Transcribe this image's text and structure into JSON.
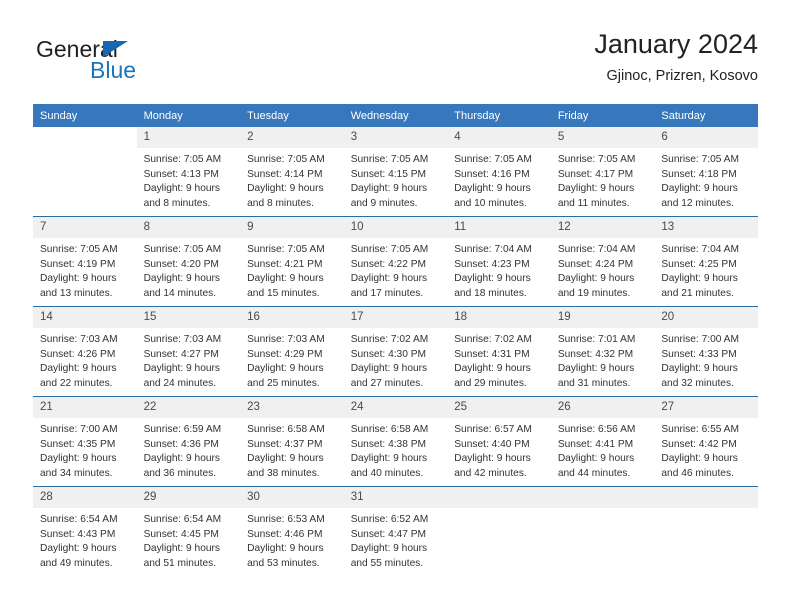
{
  "brand": {
    "name_part1": "General",
    "name_part2": "Blue"
  },
  "header": {
    "title": "January 2024",
    "subtitle": "Gjinoc, Prizren, Kosovo"
  },
  "weekday_headers": [
    "Sunday",
    "Monday",
    "Tuesday",
    "Wednesday",
    "Thursday",
    "Friday",
    "Saturday"
  ],
  "colors": {
    "header_band": "#3778bc",
    "week_divider": "#2b6ca3",
    "daynum_bg": "#f0f0f0",
    "brand_blue": "#1b75bb",
    "text": "#333333"
  },
  "weeks": [
    [
      {
        "day": "",
        "sunrise": "",
        "sunset": "",
        "daylight_line1": "",
        "daylight_line2": "",
        "empty": true
      },
      {
        "day": "1",
        "sunrise": "Sunrise: 7:05 AM",
        "sunset": "Sunset: 4:13 PM",
        "daylight_line1": "Daylight: 9 hours",
        "daylight_line2": "and 8 minutes."
      },
      {
        "day": "2",
        "sunrise": "Sunrise: 7:05 AM",
        "sunset": "Sunset: 4:14 PM",
        "daylight_line1": "Daylight: 9 hours",
        "daylight_line2": "and 8 minutes."
      },
      {
        "day": "3",
        "sunrise": "Sunrise: 7:05 AM",
        "sunset": "Sunset: 4:15 PM",
        "daylight_line1": "Daylight: 9 hours",
        "daylight_line2": "and 9 minutes."
      },
      {
        "day": "4",
        "sunrise": "Sunrise: 7:05 AM",
        "sunset": "Sunset: 4:16 PM",
        "daylight_line1": "Daylight: 9 hours",
        "daylight_line2": "and 10 minutes."
      },
      {
        "day": "5",
        "sunrise": "Sunrise: 7:05 AM",
        "sunset": "Sunset: 4:17 PM",
        "daylight_line1": "Daylight: 9 hours",
        "daylight_line2": "and 11 minutes."
      },
      {
        "day": "6",
        "sunrise": "Sunrise: 7:05 AM",
        "sunset": "Sunset: 4:18 PM",
        "daylight_line1": "Daylight: 9 hours",
        "daylight_line2": "and 12 minutes."
      }
    ],
    [
      {
        "day": "7",
        "sunrise": "Sunrise: 7:05 AM",
        "sunset": "Sunset: 4:19 PM",
        "daylight_line1": "Daylight: 9 hours",
        "daylight_line2": "and 13 minutes."
      },
      {
        "day": "8",
        "sunrise": "Sunrise: 7:05 AM",
        "sunset": "Sunset: 4:20 PM",
        "daylight_line1": "Daylight: 9 hours",
        "daylight_line2": "and 14 minutes."
      },
      {
        "day": "9",
        "sunrise": "Sunrise: 7:05 AM",
        "sunset": "Sunset: 4:21 PM",
        "daylight_line1": "Daylight: 9 hours",
        "daylight_line2": "and 15 minutes."
      },
      {
        "day": "10",
        "sunrise": "Sunrise: 7:05 AM",
        "sunset": "Sunset: 4:22 PM",
        "daylight_line1": "Daylight: 9 hours",
        "daylight_line2": "and 17 minutes."
      },
      {
        "day": "11",
        "sunrise": "Sunrise: 7:04 AM",
        "sunset": "Sunset: 4:23 PM",
        "daylight_line1": "Daylight: 9 hours",
        "daylight_line2": "and 18 minutes."
      },
      {
        "day": "12",
        "sunrise": "Sunrise: 7:04 AM",
        "sunset": "Sunset: 4:24 PM",
        "daylight_line1": "Daylight: 9 hours",
        "daylight_line2": "and 19 minutes."
      },
      {
        "day": "13",
        "sunrise": "Sunrise: 7:04 AM",
        "sunset": "Sunset: 4:25 PM",
        "daylight_line1": "Daylight: 9 hours",
        "daylight_line2": "and 21 minutes."
      }
    ],
    [
      {
        "day": "14",
        "sunrise": "Sunrise: 7:03 AM",
        "sunset": "Sunset: 4:26 PM",
        "daylight_line1": "Daylight: 9 hours",
        "daylight_line2": "and 22 minutes."
      },
      {
        "day": "15",
        "sunrise": "Sunrise: 7:03 AM",
        "sunset": "Sunset: 4:27 PM",
        "daylight_line1": "Daylight: 9 hours",
        "daylight_line2": "and 24 minutes."
      },
      {
        "day": "16",
        "sunrise": "Sunrise: 7:03 AM",
        "sunset": "Sunset: 4:29 PM",
        "daylight_line1": "Daylight: 9 hours",
        "daylight_line2": "and 25 minutes."
      },
      {
        "day": "17",
        "sunrise": "Sunrise: 7:02 AM",
        "sunset": "Sunset: 4:30 PM",
        "daylight_line1": "Daylight: 9 hours",
        "daylight_line2": "and 27 minutes."
      },
      {
        "day": "18",
        "sunrise": "Sunrise: 7:02 AM",
        "sunset": "Sunset: 4:31 PM",
        "daylight_line1": "Daylight: 9 hours",
        "daylight_line2": "and 29 minutes."
      },
      {
        "day": "19",
        "sunrise": "Sunrise: 7:01 AM",
        "sunset": "Sunset: 4:32 PM",
        "daylight_line1": "Daylight: 9 hours",
        "daylight_line2": "and 31 minutes."
      },
      {
        "day": "20",
        "sunrise": "Sunrise: 7:00 AM",
        "sunset": "Sunset: 4:33 PM",
        "daylight_line1": "Daylight: 9 hours",
        "daylight_line2": "and 32 minutes."
      }
    ],
    [
      {
        "day": "21",
        "sunrise": "Sunrise: 7:00 AM",
        "sunset": "Sunset: 4:35 PM",
        "daylight_line1": "Daylight: 9 hours",
        "daylight_line2": "and 34 minutes."
      },
      {
        "day": "22",
        "sunrise": "Sunrise: 6:59 AM",
        "sunset": "Sunset: 4:36 PM",
        "daylight_line1": "Daylight: 9 hours",
        "daylight_line2": "and 36 minutes."
      },
      {
        "day": "23",
        "sunrise": "Sunrise: 6:58 AM",
        "sunset": "Sunset: 4:37 PM",
        "daylight_line1": "Daylight: 9 hours",
        "daylight_line2": "and 38 minutes."
      },
      {
        "day": "24",
        "sunrise": "Sunrise: 6:58 AM",
        "sunset": "Sunset: 4:38 PM",
        "daylight_line1": "Daylight: 9 hours",
        "daylight_line2": "and 40 minutes."
      },
      {
        "day": "25",
        "sunrise": "Sunrise: 6:57 AM",
        "sunset": "Sunset: 4:40 PM",
        "daylight_line1": "Daylight: 9 hours",
        "daylight_line2": "and 42 minutes."
      },
      {
        "day": "26",
        "sunrise": "Sunrise: 6:56 AM",
        "sunset": "Sunset: 4:41 PM",
        "daylight_line1": "Daylight: 9 hours",
        "daylight_line2": "and 44 minutes."
      },
      {
        "day": "27",
        "sunrise": "Sunrise: 6:55 AM",
        "sunset": "Sunset: 4:42 PM",
        "daylight_line1": "Daylight: 9 hours",
        "daylight_line2": "and 46 minutes."
      }
    ],
    [
      {
        "day": "28",
        "sunrise": "Sunrise: 6:54 AM",
        "sunset": "Sunset: 4:43 PM",
        "daylight_line1": "Daylight: 9 hours",
        "daylight_line2": "and 49 minutes."
      },
      {
        "day": "29",
        "sunrise": "Sunrise: 6:54 AM",
        "sunset": "Sunset: 4:45 PM",
        "daylight_line1": "Daylight: 9 hours",
        "daylight_line2": "and 51 minutes."
      },
      {
        "day": "30",
        "sunrise": "Sunrise: 6:53 AM",
        "sunset": "Sunset: 4:46 PM",
        "daylight_line1": "Daylight: 9 hours",
        "daylight_line2": "and 53 minutes."
      },
      {
        "day": "31",
        "sunrise": "Sunrise: 6:52 AM",
        "sunset": "Sunset: 4:47 PM",
        "daylight_line1": "Daylight: 9 hours",
        "daylight_line2": "and 55 minutes."
      },
      {
        "day": "",
        "sunrise": "",
        "sunset": "",
        "daylight_line1": "",
        "daylight_line2": "",
        "empty": true
      },
      {
        "day": "",
        "sunrise": "",
        "sunset": "",
        "daylight_line1": "",
        "daylight_line2": "",
        "empty": true
      },
      {
        "day": "",
        "sunrise": "",
        "sunset": "",
        "daylight_line1": "",
        "daylight_line2": "",
        "empty": true
      }
    ]
  ]
}
